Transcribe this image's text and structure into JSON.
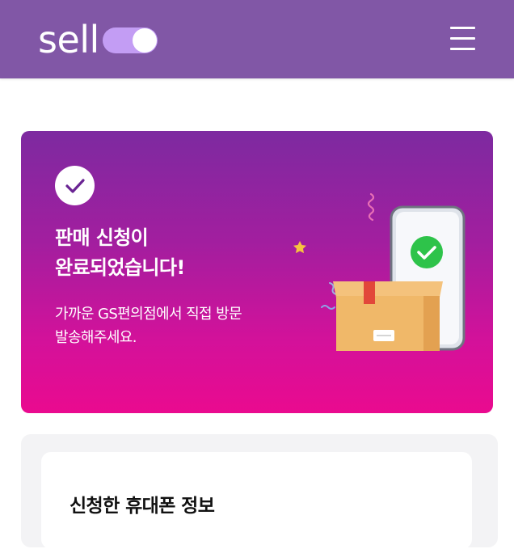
{
  "header": {
    "logo_text": "sell",
    "logo_icon": "toggle-switch-icon",
    "menu_icon": "hamburger-menu-icon",
    "background_color": "#8157a6"
  },
  "hero": {
    "check_icon": "checkmark-circle-icon",
    "title_line1": "판매 신청이",
    "title_line2": "완료되었습니다!",
    "desc_line1": "가까운 GS편의점에서 직접 방문",
    "desc_line2": "발송해주세요.",
    "illustration": "phone-and-package-illustration",
    "gradient_top": "#7d2aa0",
    "gradient_bottom": "#ea0a8f"
  },
  "info": {
    "title": "신청한 휴대폰 정보"
  }
}
